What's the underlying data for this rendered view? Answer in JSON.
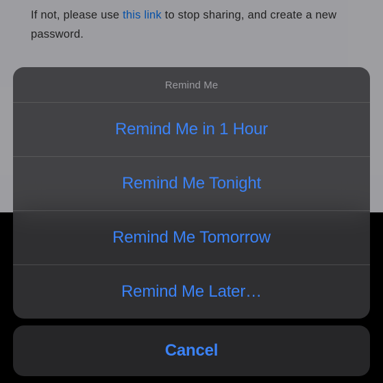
{
  "background": {
    "text_before_link": "If not, please use ",
    "link_text": "this link",
    "text_after_link": " to stop sharing, and create a new password."
  },
  "sheet": {
    "title": "Remind Me",
    "options": [
      "Remind Me in 1 Hour",
      "Remind Me Tonight",
      "Remind Me Tomorrow",
      "Remind Me Later…"
    ],
    "cancel": "Cancel"
  }
}
